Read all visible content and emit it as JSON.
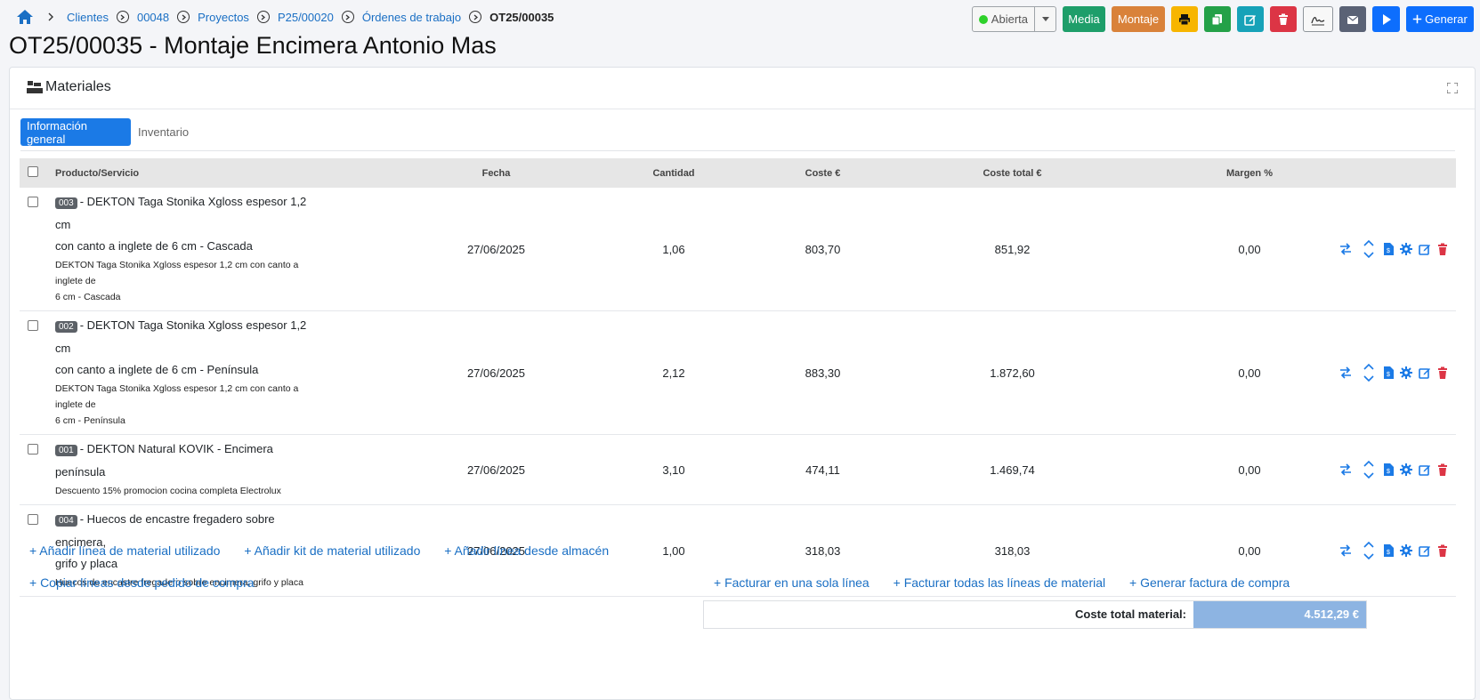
{
  "breadcrumb": {
    "items": [
      "Clientes",
      "00048",
      "Proyectos",
      "P25/00020",
      "Órdenes de trabajo"
    ],
    "current": "OT25/00035"
  },
  "toolbar": {
    "status_label": "Abierta",
    "media_label": "Media",
    "montaje_label": "Montaje",
    "generate_label": "Generar"
  },
  "page_title": "OT25/00035 - Montaje Encimera Antonio Mas",
  "card": {
    "title": "Materiales"
  },
  "tabs": [
    "Información general",
    "Inventario"
  ],
  "table": {
    "headers": [
      "Producto/Servicio",
      "Fecha",
      "Cantidad",
      "Coste €",
      "Coste total €",
      "Margen %"
    ],
    "rows": [
      {
        "code": "003",
        "name_line1": "- DEKTON Taga Stonika Xgloss espesor 1,2 cm",
        "name_line2": "con canto a inglete de 6 cm - Cascada",
        "desc_line1": "DEKTON Taga Stonika Xgloss espesor 1,2 cm con canto a inglete de",
        "desc_line2": "6 cm - Cascada",
        "fecha": "27/06/2025",
        "cantidad": "1,06",
        "coste": "803,70",
        "coste_total": "851,92",
        "margen": "0,00"
      },
      {
        "code": "002",
        "name_line1": "- DEKTON Taga Stonika Xgloss espesor 1,2 cm",
        "name_line2": "con canto a inglete de 6 cm - Península",
        "desc_line1": "DEKTON Taga Stonika Xgloss espesor 1,2 cm con canto a inglete de",
        "desc_line2": "6 cm - Península",
        "fecha": "27/06/2025",
        "cantidad": "2,12",
        "coste": "883,30",
        "coste_total": "1.872,60",
        "margen": "0,00"
      },
      {
        "code": "001",
        "name_line1": "- DEKTON Natural KOVIK - Encimera península",
        "name_line2": "",
        "desc_line1": "Descuento 15% promocion cocina completa Electrolux",
        "desc_line2": "",
        "fecha": "27/06/2025",
        "cantidad": "3,10",
        "coste": "474,11",
        "coste_total": "1.469,74",
        "margen": "0,00"
      },
      {
        "code": "004",
        "name_line1": "- Huecos de encastre fregadero sobre encimera,",
        "name_line2": "grifo y placa",
        "desc_line1": "Huecos de encastre fregadero sobre encimera, grifo y placa",
        "desc_line2": "",
        "fecha": "27/06/2025",
        "cantidad": "1,00",
        "coste": "318,03",
        "coste_total": "318,03",
        "margen": "0,00"
      }
    ]
  },
  "links": {
    "add_material_line": "+ Añadir línea de material utilizado",
    "add_kit": "+ Añadir kit de material utilizado",
    "add_from_warehouse": "+ Añadir línea desde almacén",
    "copy_from_po": "+ Copiar líneas desde pedido de compra",
    "invoice_single_line": "+ Facturar en una sola línea",
    "invoice_all_lines": "+ Facturar todas las líneas de material",
    "generate_purchase_invoice": "+ Generar factura de compra"
  },
  "total": {
    "label": "Coste total material:",
    "value": "4.512,29 €"
  },
  "colors": {
    "primary": "#1a6fc4",
    "tab_active": "#1b7ae6",
    "media": "#1e9e6a",
    "montaje": "#d9823a",
    "danger": "#dc3545",
    "total_bg": "#8db4e2"
  },
  "icons": [
    "home-icon",
    "chevron-right-icon",
    "print-icon",
    "copy-icon",
    "edit-icon",
    "trash-icon",
    "signature-icon",
    "envelope-icon",
    "play-icon",
    "plus-icon",
    "boxes-icon",
    "expand-icon",
    "exchange-icon",
    "sort-icon",
    "file-invoice-icon",
    "gear-icon"
  ]
}
